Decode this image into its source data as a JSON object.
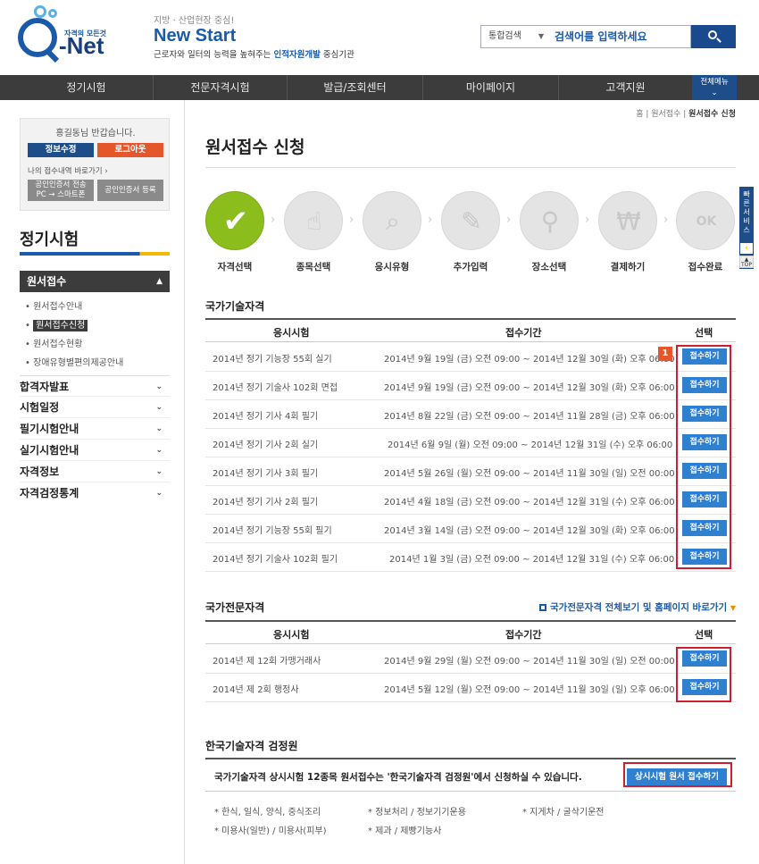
{
  "header": {
    "logo_tag": "자격의 모든것",
    "logo_text": "Q-Net",
    "slogan_small": "지방 · 산업현장 중심!",
    "slogan_big": "New Start",
    "slogan_desc_pre": "근로자와 일터의 능력을 높혀주는 ",
    "slogan_desc_bold": "인적자원개발",
    "slogan_desc_post": " 중심기관",
    "search_scope": "통합검색",
    "search_placeholder": "검색어를 입력하세요"
  },
  "gnb": {
    "items": [
      "정기시험",
      "전문자격시험",
      "발급/조회센터",
      "마이페이지",
      "고객지원"
    ],
    "all_menu": "전체메뉴"
  },
  "login": {
    "greeting": "홍길동님 반갑습니다.",
    "edit_info": "정보수정",
    "logout": "로그아웃",
    "shortcut": "나의 접수내역 바로가기",
    "cert_transfer_1": "공인인증서 전송",
    "cert_transfer_2": "PC → 스마트폰",
    "cert_register": "공인인증서 등록"
  },
  "sidebar": {
    "title": "정기시험",
    "open_menu": "원서접수",
    "submenu": [
      "원서접수안내",
      "원서접수신청",
      "원서접수현황",
      "장애유형별편의제공안내"
    ],
    "menus": [
      "합격자발표",
      "시험일정",
      "필기시험안내",
      "실기시험안내",
      "자격정보",
      "자격검정통계"
    ]
  },
  "breadcrumb": {
    "home": "홈",
    "parent": "원서접수",
    "current": "원서접수 신청"
  },
  "page_title": "원서접수 신청",
  "steps": [
    "자격선택",
    "종목선택",
    "응시유형",
    "추가입력",
    "장소선택",
    "결제하기",
    "접수완료"
  ],
  "step_icons": [
    "check-icon",
    "hand-pointer-icon",
    "magnifier-icon",
    "pencil-icon",
    "location-pin-icon",
    "won-coin-icon",
    "ok-monitor-icon"
  ],
  "national": {
    "title": "국가기술자격",
    "columns": [
      "응시시험",
      "접수기간",
      "선택"
    ],
    "badge": "1",
    "rows": [
      {
        "exam": "2014년 정기 기능장 55회 실기",
        "period": "2014년 9월 19일 (금) 오전 09:00 ~ 2014년 12월 30일 (화) 오후 06:00",
        "action": "접수하기"
      },
      {
        "exam": "2014년 정기 기술사 102회 면접",
        "period": "2014년 9월 19일 (금) 오전 09:00 ~ 2014년 12월 30일 (화) 오후 06:00",
        "action": "접수하기"
      },
      {
        "exam": "2014년 정기 기사 4회 필기",
        "period": "2014년 8월 22일 (금) 오전 09:00 ~ 2014년 11월 28일 (금) 오후 06:00",
        "action": "접수하기"
      },
      {
        "exam": "2014년 정기 기사 2회 실기",
        "period": "2014년 6월 9일 (월) 오전 09:00 ~ 2014년 12월 31일 (수) 오후 06:00",
        "action": "접수하기"
      },
      {
        "exam": "2014년 정기 기사 3회 필기",
        "period": "2014년 5월 26일 (월) 오전 09:00 ~ 2014년 11월 30일 (일) 오전 00:00",
        "action": "접수하기"
      },
      {
        "exam": "2014년 정기 기사 2회 필기",
        "period": "2014년 4월 18일 (금) 오전 09:00 ~ 2014년 12월 31일 (수) 오후 06:00",
        "action": "접수하기"
      },
      {
        "exam": "2014년 정기 기능장 55회 필기",
        "period": "2014년 3월 14일 (금) 오전 09:00 ~ 2014년 12월 30일 (화) 오후 06:00",
        "action": "접수하기"
      },
      {
        "exam": "2014년 정기 기술사 102회 필기",
        "period": "2014년 1월 3일 (금) 오전 09:00 ~ 2014년 12월 31일 (수) 오후 06:00",
        "action": "접수하기"
      }
    ]
  },
  "professional": {
    "title": "국가전문자격",
    "link": "국가전문자격 전체보기 및 홈페이지 바로가기",
    "columns": [
      "응시시험",
      "접수기간",
      "선택"
    ],
    "rows": [
      {
        "exam": "2014년 제 12회 가맹거래사",
        "period": "2014년 9월 29일 (월) 오전 09:00 ~ 2014년 11월 30일 (일) 오전 00:00",
        "action": "접수하기"
      },
      {
        "exam": "2014년 제 2회 행정사",
        "period": "2014년 5월 12일 (월) 오전 09:00 ~ 2014년 11월 30일 (일) 오후 06:00",
        "action": "접수하기"
      }
    ]
  },
  "korea_tech": {
    "title": "한국기술자격 검정원",
    "message": "국가기술자격 상시시험 12종목 원서접수는 '한국기술자격 검정원'에서 신청하실 수 있습니다.",
    "button": "상시시험 원서 접수하기",
    "notes": [
      "* 한식, 일식, 양식, 중식조리",
      "* 정보처리 / 정보기기운용",
      "* 지게차 / 굴삭기운전",
      "* 미용사(일반) / 미용사(피부)",
      "* 제과 / 제빵기능사"
    ]
  },
  "quick": {
    "label": "빠른서비스",
    "top": "TOP"
  },
  "colors": {
    "brand_blue": "#1a5aa8",
    "step_active": "#8bbd1c",
    "apply_button": "#2f80d0",
    "highlight_red": "#cc1f2f"
  }
}
